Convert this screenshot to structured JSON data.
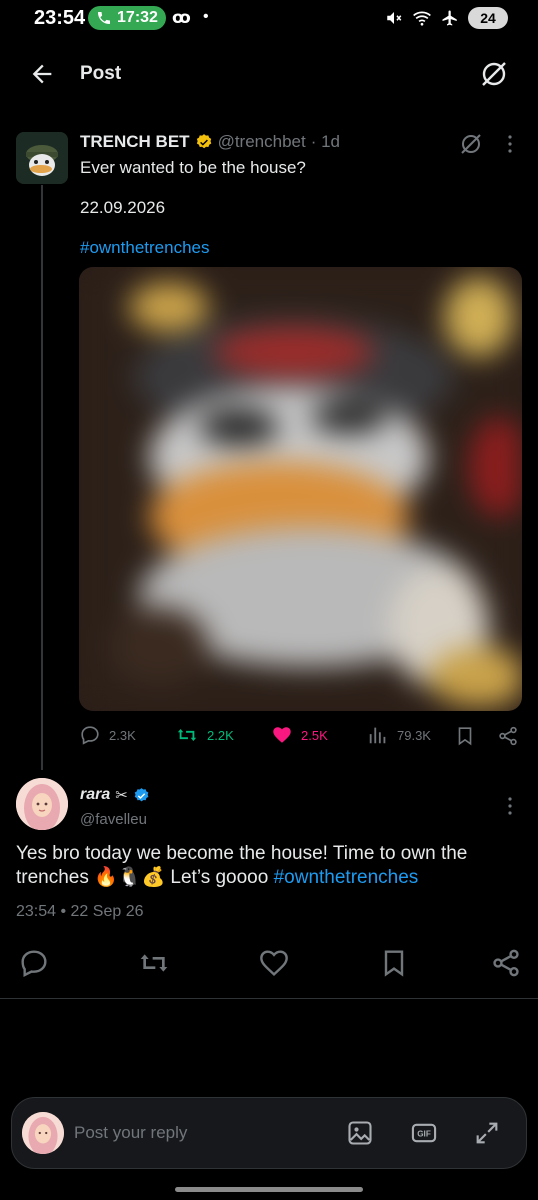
{
  "status_bar": {
    "time": "23:54",
    "call_time": "17:32",
    "battery": "24"
  },
  "header": {
    "title": "Post"
  },
  "post": {
    "author_name": "TRENCH BET",
    "handle": "@trenchbet",
    "age": "· 1d",
    "text_line1": "Ever wanted to be the house?",
    "text_line2": "22.09.2026",
    "hashtag": "#ownthetrenches",
    "stats": {
      "replies": "2.3K",
      "reposts": "2.2K",
      "likes": "2.5K",
      "views": "79.3K"
    }
  },
  "reply": {
    "author_name": "rara",
    "handle": "@favelleu",
    "text_part1": "Yes bro today we become the house! Time to own the trenches 🔥🐧💰 Let’s goooo ",
    "hashtag": "#ownthetrenches",
    "timestamp": "23:54 • 22 Sep 26"
  },
  "composer": {
    "placeholder": "Post your reply"
  },
  "colors": {
    "accent": "#1d9bf0",
    "like": "#f91880",
    "repost": "#00ba7c",
    "gold_badge": "#f4c20d",
    "muted": "#71767b"
  },
  "icons": [
    "back-arrow-icon",
    "grok-icon",
    "more-icon",
    "reply-icon",
    "repost-icon",
    "heart-icon",
    "views-icon",
    "bookmark-icon",
    "share-icon",
    "image-icon",
    "gif-icon",
    "expand-icon"
  ]
}
